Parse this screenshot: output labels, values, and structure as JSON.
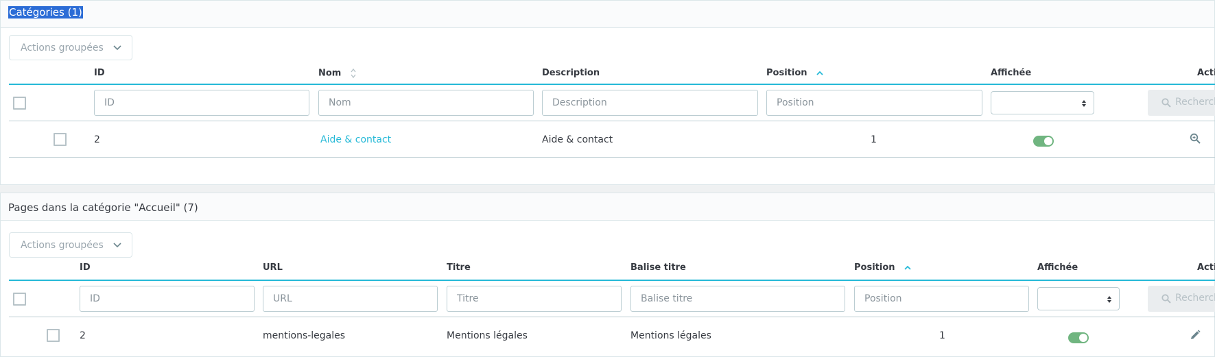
{
  "categories": {
    "title": "Catégories (1)",
    "bulk_actions_label": "Actions groupées",
    "columns": {
      "id": "ID",
      "name": "Nom",
      "description": "Description",
      "position": "Position",
      "displayed": "Affichée",
      "actions": "Acti"
    },
    "filters": {
      "id_placeholder": "ID",
      "name_placeholder": "Nom",
      "description_placeholder": "Description",
      "position_placeholder": "Position",
      "search_label": "Recherch"
    },
    "rows": [
      {
        "id": "2",
        "name": "Aide & contact",
        "description": "Aide & contact",
        "position": "1",
        "displayed": true
      }
    ]
  },
  "pages": {
    "title": "Pages dans la catégorie \"Accueil\" (7)",
    "bulk_actions_label": "Actions groupées",
    "columns": {
      "id": "ID",
      "url": "URL",
      "title": "Titre",
      "meta_title": "Balise titre",
      "position": "Position",
      "displayed": "Affichée",
      "actions": "Acti"
    },
    "filters": {
      "id_placeholder": "ID",
      "url_placeholder": "URL",
      "title_placeholder": "Titre",
      "meta_title_placeholder": "Balise titre",
      "position_placeholder": "Position",
      "search_label": "Recherch"
    },
    "rows": [
      {
        "id": "2",
        "url": "mentions-legales",
        "title": "Mentions légales",
        "meta_title": "Mentions légales",
        "position": "1",
        "displayed": true
      }
    ]
  },
  "colors": {
    "accent": "#25b9d7",
    "toggle_on": "#70b580",
    "selection": "#2b6cd6"
  }
}
